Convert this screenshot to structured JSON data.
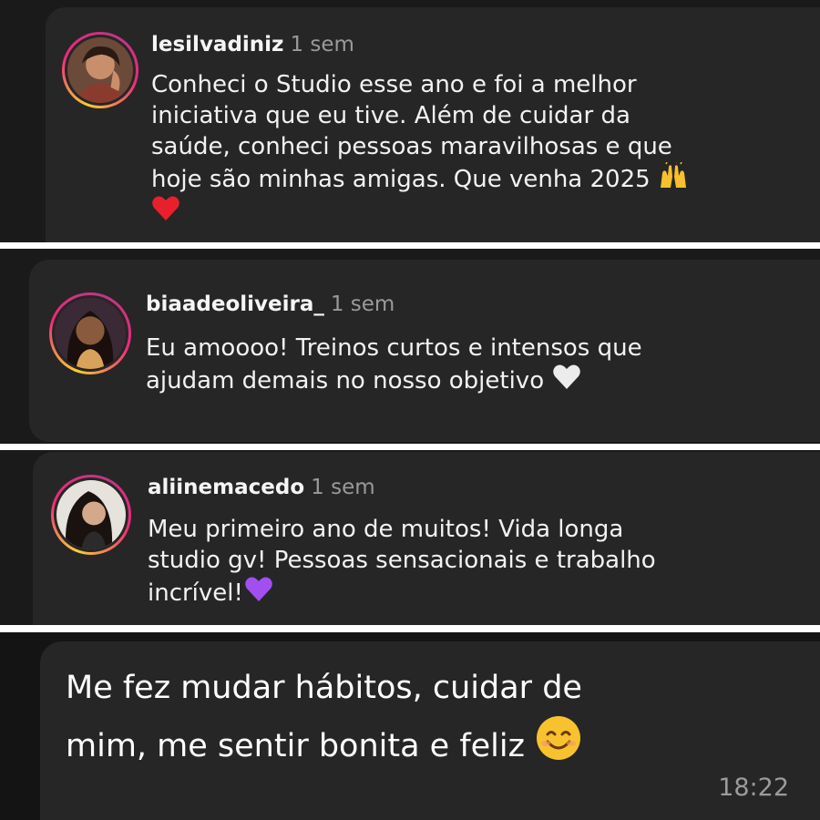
{
  "comments": [
    {
      "username": "lesilvadiniz",
      "time": "1 sem",
      "lines": [
        "Conheci o Studio esse ano e foi a melhor",
        "iniciativa que eu tive. Além de cuidar da",
        "saúde, conheci pessoas maravilhosas e que",
        "hoje são minhas amigas. Que venha 2025"
      ],
      "emojis": [
        "raising-hands-emoji",
        "red-heart-emoji"
      ]
    },
    {
      "username": "biaadeoliveira_",
      "time": "1 sem",
      "lines": [
        "Eu amoooo! Treinos curtos e intensos que",
        "ajudam demais no nosso objetivo"
      ],
      "emojis": [
        "white-heart-emoji"
      ]
    },
    {
      "username": "aliinemacedo",
      "time": "1 sem",
      "lines": [
        "Meu primeiro ano de muitos! Vida longa",
        "studio gv! Pessoas sensacionais e trabalho",
        "incrível!"
      ],
      "emojis": [
        "purple-heart-emoji"
      ]
    }
  ],
  "chat_message": {
    "lines": [
      "Me fez mudar hábitos, cuidar de",
      "mim, me sentir bonita e feliz"
    ],
    "emoji": "smiling-face-emoji",
    "time": "18:22"
  },
  "colors": {
    "background": "#1a1a1a",
    "card": "#262626",
    "text": "#f2f2f2",
    "muted": "#9a9a9a",
    "divider": "#ffffff",
    "story_ring_start": "#f9ce34",
    "story_ring_end": "#c13584"
  }
}
